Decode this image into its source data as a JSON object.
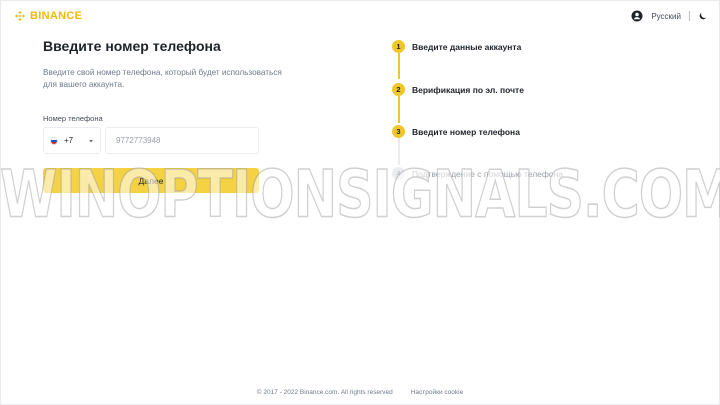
{
  "header": {
    "brand": "BINANCE",
    "language": "Русский",
    "brand_color": "#F0B90B"
  },
  "form": {
    "title": "Введите номер телефона",
    "description": "Введите свой номер телефона, который будет использоваться для вашего аккаунта.",
    "phone_label": "Номер телефона",
    "country_code": "+7",
    "phone_value": "9772773948",
    "submit_label": "Далее"
  },
  "steps": [
    {
      "number": "1",
      "label": "Введите данные аккаунта",
      "state": "done"
    },
    {
      "number": "2",
      "label": "Верификация по эл. почте",
      "state": "done"
    },
    {
      "number": "3",
      "label": "Введите номер телефона",
      "state": "active"
    },
    {
      "number": "4",
      "label": "Подтверждение с помощью телефона",
      "state": "pending"
    }
  ],
  "watermark": "WINOPTIONSIGNALS.COM",
  "footer": {
    "copyright": "© 2017 - 2022 Binance.com. All rights reserved",
    "cookie_settings": "Настройки cookie"
  }
}
